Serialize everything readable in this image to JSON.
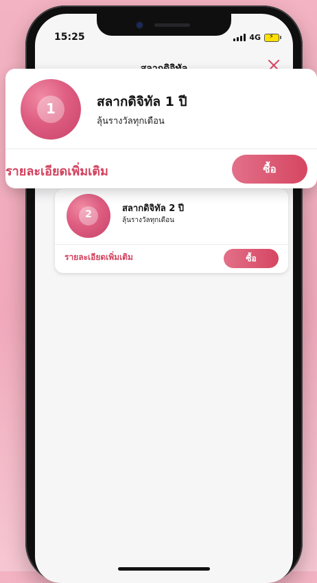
{
  "status_bar": {
    "time": "15:25",
    "network": "4G"
  },
  "header": {
    "title": "สลากดิจิทัล"
  },
  "cards": [
    {
      "badge_number": "1",
      "title": "สลากดิจิทัล 1 ปี",
      "subtitle": "ลุ้นรางวัลทุกเดือน",
      "details_label": "รายละเอียดเพิ่มเติม",
      "buy_label": "ซื้อ"
    },
    {
      "badge_number": "2",
      "title": "สลากดิจิทัล 2 ปี",
      "subtitle": "ลุ้นรางวัลทุกเดือน",
      "details_label": "รายละเอียดเพิ่มเติม",
      "buy_label": "ซื้อ"
    }
  ],
  "colors": {
    "accent": "#d64662",
    "background": "#f0a9bb",
    "battery": "#ffe000"
  },
  "icons": {
    "close": "close-icon",
    "signal": "signal-icon",
    "battery": "battery-charging-icon"
  }
}
